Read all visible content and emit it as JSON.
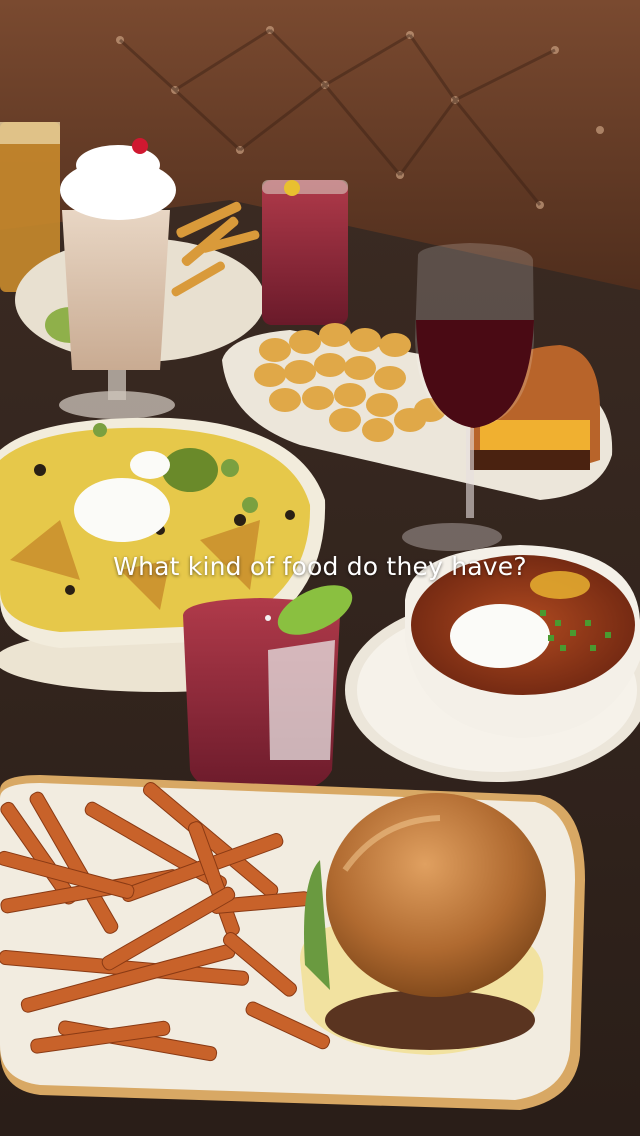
{
  "video": {
    "caption": "What kind of food do they have?"
  }
}
